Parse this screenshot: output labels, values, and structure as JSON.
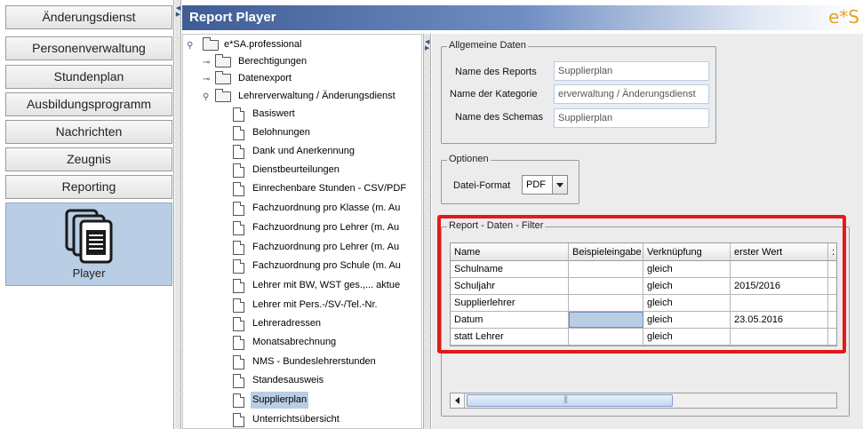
{
  "nav": {
    "items": [
      {
        "label": "Änderungsdienst"
      },
      {
        "label": "Personenverwaltung"
      },
      {
        "label": "Stundenplan"
      },
      {
        "label": "Ausbildungsprogramm"
      },
      {
        "label": "Nachrichten"
      },
      {
        "label": "Zeugnis"
      },
      {
        "label": "Reporting"
      }
    ],
    "player": {
      "label": "Player",
      "icon": "documents-icon"
    }
  },
  "titlebar": {
    "title": "Report Player",
    "logo": "e*S"
  },
  "tree": {
    "root": "e*SA.professional",
    "folders": [
      "Berechtigungen",
      "Datenexport",
      "Lehrerverwaltung / Änderungsdienst"
    ],
    "reports": [
      "Basiswert",
      "Belohnungen",
      "Dank und Anerkennung",
      "Dienstbeurteilungen",
      "Einrechenbare Stunden - CSV/PDF",
      "Fachzuordnung pro Klasse (m. Au",
      "Fachzuordnung pro Lehrer (m. Au",
      "Fachzuordnung pro Lehrer (m. Au",
      "Fachzuordnung pro Schule (m. Au",
      "Lehrer mit BW,  WST ges.,... aktue",
      "Lehrer mit Pers.-/SV-/Tel.-Nr.",
      "Lehreradressen",
      "Monatsabrechnung",
      "NMS - Bundeslehrerstunden",
      "Standesausweis",
      "Supplierplan",
      "Unterrichtsübersicht"
    ],
    "selected": "Supplierplan"
  },
  "general": {
    "legend": "Allgemeine Daten",
    "report_label": "Name des Reports",
    "report_value": "Supplierplan",
    "category_label": "Name der Kategorie",
    "category_value": "erverwaltung / Änderungsdienst",
    "schema_label": "Name des Schemas",
    "schema_value": "Supplierplan"
  },
  "options": {
    "legend": "Optionen",
    "format_label": "Datei-Format",
    "format_value": "PDF"
  },
  "filter": {
    "legend": "Report - Daten - Filter",
    "columns": [
      "Name",
      "Beispieleingabe",
      "Verknüpfung",
      "erster Wert",
      ":"
    ],
    "rows": [
      {
        "name": "Schulname",
        "example": "",
        "link": "gleich",
        "first": ""
      },
      {
        "name": "Schuljahr",
        "example": "",
        "link": "gleich",
        "first": "2015/2016"
      },
      {
        "name": "Supplierlehrer",
        "example": "",
        "link": "gleich",
        "first": ""
      },
      {
        "name": "Datum",
        "example": "",
        "link": "gleich",
        "first": "23.05.2016"
      },
      {
        "name": "statt Lehrer",
        "example": "",
        "link": "gleich",
        "first": ""
      }
    ]
  },
  "colors": {
    "accent": "#3f5c95",
    "selection": "#b9cde4",
    "highlight": "#e31a1a",
    "logo": "#e8a31b"
  }
}
